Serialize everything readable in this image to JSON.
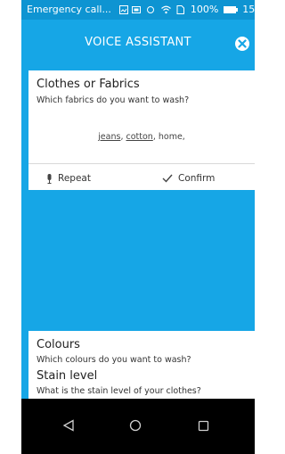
{
  "status_bar": {
    "notification_text": "Emergency call...",
    "battery": "100%",
    "time": "15:"
  },
  "app_bar": {
    "title": "VOICE ASSISTANT"
  },
  "question_card": {
    "title": "Clothes or Fabrics",
    "prompt": "Which fabrics do you want to wash?",
    "answer": {
      "word1": "jeans",
      "sep1": ", ",
      "word2": "cotton",
      "sep2": ", ",
      "word3": "home",
      "sep3": ","
    },
    "actions": {
      "repeat": "Repeat",
      "confirm": "Confirm"
    }
  },
  "next_questions": [
    {
      "title": "Colours",
      "prompt": "Which colours do you want to wash?"
    },
    {
      "title": "Stain level",
      "prompt": "What is the stain level of your clothes?"
    }
  ],
  "colors": {
    "accent": "#16a6e6",
    "status_bar": "#0e94d2",
    "nav_bar": "#000000"
  },
  "icons": {
    "close": "close-circle-icon",
    "repeat": "microphone-icon",
    "confirm": "checkmark-icon",
    "back": "back-triangle-icon",
    "home": "home-circle-icon",
    "recents": "recents-square-icon"
  }
}
